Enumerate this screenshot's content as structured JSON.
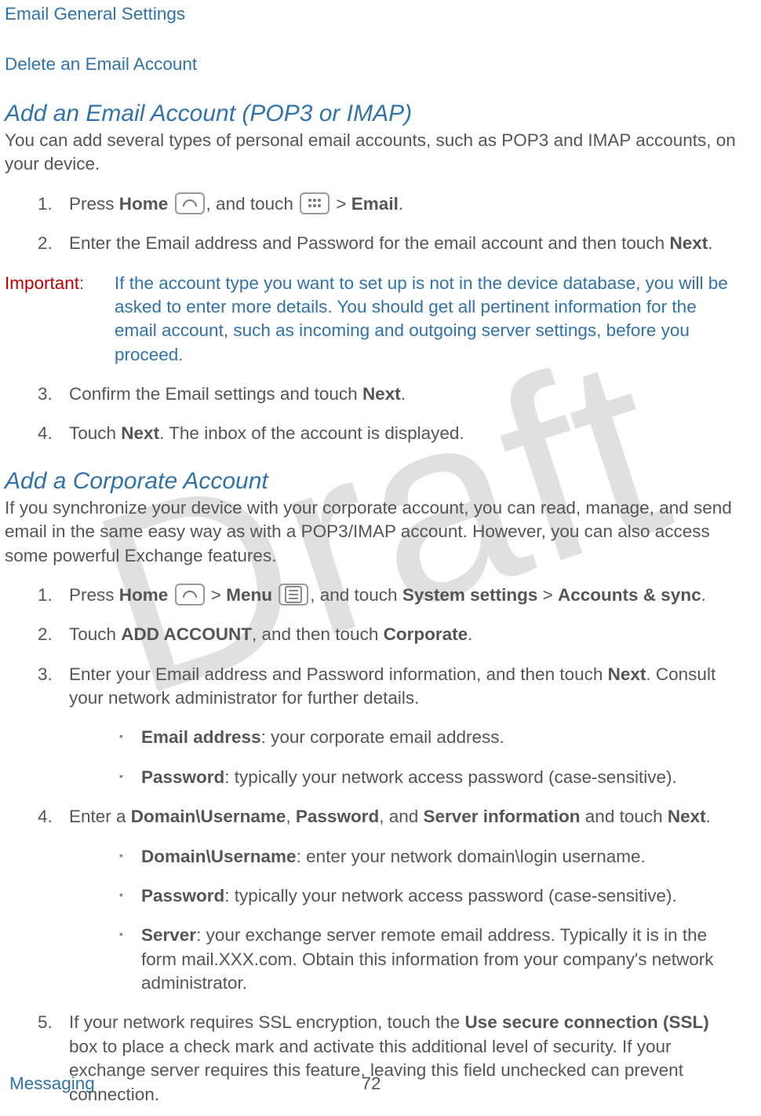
{
  "watermark": "Draft",
  "toc_links": {
    "email_general_settings": "Email General Settings",
    "delete_account": "Delete an Email Account"
  },
  "section1": {
    "heading": "Add an Email Account (POP3 or IMAP)",
    "intro": "You can add several types of personal email accounts, such as POP3 and IMAP accounts, on your device.",
    "steps": {
      "s1_a": "Press ",
      "s1_home": "Home",
      "s1_b": ", and touch ",
      "s1_c": " > ",
      "s1_email": "Email",
      "s1_d": ".",
      "s2_a": "Enter the Email address and Password for the email account and then touch ",
      "s2_next": "Next",
      "s2_b": ".",
      "s3_a": "Confirm the Email settings and touch ",
      "s3_next": "Next",
      "s3_b": ".",
      "s4_a": "Touch ",
      "s4_next": "Next",
      "s4_b": ". The inbox of the account is displayed."
    },
    "important": {
      "label": "Important",
      "colon": ":",
      "text": "If the account type you want to set up is not in the device database, you will be asked to enter more details. You should get all pertinent information for the email account, such as incoming and outgoing server settings, before you proceed."
    }
  },
  "section2": {
    "heading": "Add a Corporate Account",
    "intro": "If you synchronize your device with your corporate account, you can read, manage, and send email in the same easy way as with a POP3/IMAP account. However, you can also access some powerful Exchange features.",
    "steps": {
      "s1_a": "Press ",
      "s1_home": "Home",
      "s1_b": " > ",
      "s1_menu": "Menu",
      "s1_c": ", and touch ",
      "s1_sys": "System settings",
      "s1_d": " > ",
      "s1_acct": "Accounts & sync",
      "s1_e": ".",
      "s2_a": "Touch ",
      "s2_add": "ADD ACCOUNT",
      "s2_b": ", and then touch ",
      "s2_corp": "Corporate",
      "s2_c": ".",
      "s3_a": "Enter your Email address and Password information, and then touch ",
      "s3_next": "Next",
      "s3_b": ". Consult your network administrator for further details.",
      "s3_sub1_k": "Email address",
      "s3_sub1_v": ": your corporate email address.",
      "s3_sub2_k": "Password",
      "s3_sub2_v": ": typically your network access password (case-sensitive).",
      "s4_a": "Enter a ",
      "s4_du": "Domain\\Username",
      "s4_b": ", ",
      "s4_pw": "Password",
      "s4_c": ", and ",
      "s4_si": "Server information",
      "s4_d": " and touch ",
      "s4_next": "Next",
      "s4_e": ".",
      "s4_sub1_k": "Domain\\Username",
      "s4_sub1_v": ": enter your network domain\\login username.",
      "s4_sub2_k": "Password",
      "s4_sub2_v": ": typically your network access password (case-sensitive).",
      "s4_sub3_k": "Server",
      "s4_sub3_v": ": your exchange server remote email address. Typically it is in the form mail.XXX.com. Obtain this information from your company's network administrator.",
      "s5_a": "If your network requires SSL encryption, touch the ",
      "s5_ssl": "Use secure connection (SSL)",
      "s5_b": " box to place a check mark and activate this additional level of security. If your exchange server requires this feature, leaving this field unchecked can prevent connection."
    }
  },
  "footer": {
    "section": "Messaging",
    "page": "72"
  }
}
